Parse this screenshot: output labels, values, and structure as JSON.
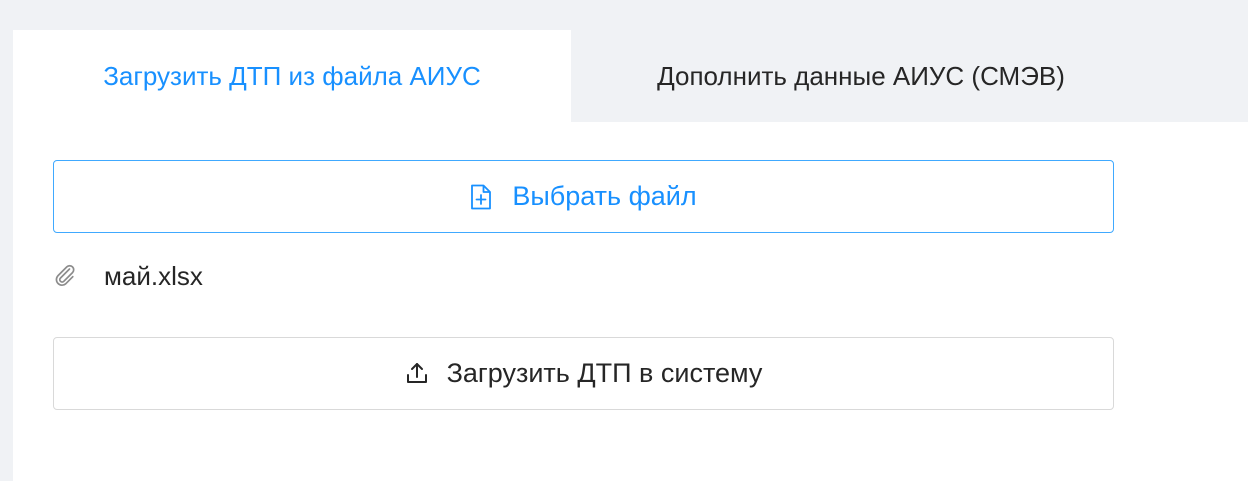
{
  "tabs": {
    "active_label": "Загрузить ДТП из файла АИУС",
    "inactive_label": "Дополнить данные АИУС (СМЭВ)"
  },
  "select_button": {
    "label": "Выбрать файл",
    "icon": "file-add-icon"
  },
  "attachment": {
    "filename": "май.xlsx",
    "icon": "paperclip-icon"
  },
  "upload_button": {
    "label": "Загрузить ДТП в систему",
    "icon": "upload-icon"
  },
  "colors": {
    "accent": "#1890ff",
    "text": "#262626",
    "background": "#f0f2f5",
    "border": "#d9d9d9"
  }
}
